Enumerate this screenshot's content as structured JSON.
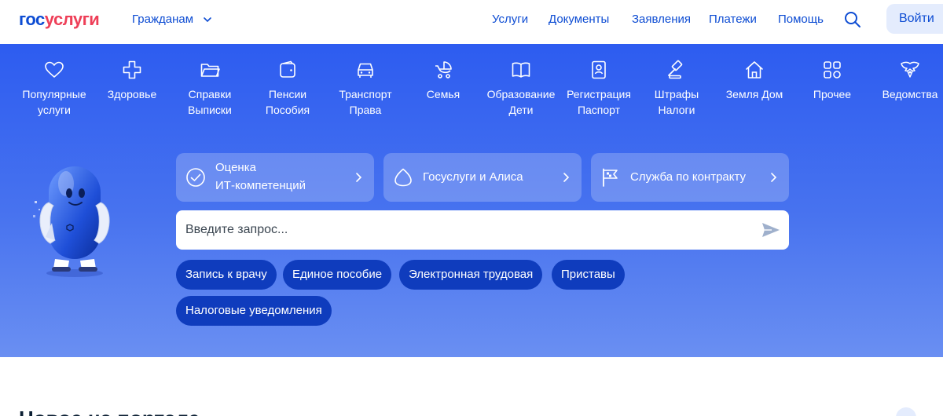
{
  "header": {
    "logo_part1": "гос",
    "logo_part2": "услуги",
    "role_selector": "Гражданам",
    "nav": [
      "Услуги",
      "Документы",
      "Заявления",
      "Платежи",
      "Помощь"
    ],
    "search_icon": "search-icon",
    "login_label": "Войти"
  },
  "categories": [
    {
      "label": "Популярные услуги",
      "icon": "heart-icon"
    },
    {
      "label": "Здоровье",
      "icon": "medical-cross-icon"
    },
    {
      "label": "Справки Выписки",
      "icon": "folder-icon"
    },
    {
      "label": "Пенсии Пособия",
      "icon": "wallet-icon"
    },
    {
      "label": "Транспорт Права",
      "icon": "car-icon"
    },
    {
      "label": "Семья",
      "icon": "stroller-icon"
    },
    {
      "label": "Образование Дети",
      "icon": "book-icon"
    },
    {
      "label": "Регистрация Паспорт",
      "icon": "passport-icon"
    },
    {
      "label": "Штрафы Налоги",
      "icon": "gavel-icon"
    },
    {
      "label": "Земля Дом",
      "icon": "house-icon"
    },
    {
      "label": "Прочее",
      "icon": "grid-icon"
    },
    {
      "label": "Ведомства",
      "icon": "emblem-icon"
    }
  ],
  "cat_lines": [
    [
      "Популярные",
      "услуги"
    ],
    [
      "Здоровье",
      ""
    ],
    [
      "Справки",
      "Выписки"
    ],
    [
      "Пенсии",
      "Пособия"
    ],
    [
      "Транспорт",
      "Права"
    ],
    [
      "Семья",
      ""
    ],
    [
      "Образование",
      "Дети"
    ],
    [
      "Регистрация",
      "Паспорт"
    ],
    [
      "Штрафы",
      "Налоги"
    ],
    [
      "Земля Дом",
      ""
    ],
    [
      "Прочее",
      ""
    ],
    [
      "Ведомства",
      ""
    ]
  ],
  "promos": [
    {
      "line1": "Оценка",
      "line2": "ИТ-компетенций",
      "icon": "check-circle-icon"
    },
    {
      "line1": "Госуслуги и Алиса",
      "line2": "",
      "icon": "alice-icon"
    },
    {
      "line1": "Служба по контракту",
      "line2": "",
      "icon": "flag-icon"
    }
  ],
  "search": {
    "placeholder": "Введите запрос..."
  },
  "chips": [
    "Запись к врачу",
    "Единое пособие",
    "Электронная трудовая",
    "Приставы",
    "Налоговые уведомления"
  ],
  "news_title": "Новое на портале",
  "colors": {
    "brand_blue": "#0d4cd3",
    "brand_red": "#ee3f58",
    "hero_top": "#2d5cf0",
    "chip_bg": "#0f3cbd"
  }
}
